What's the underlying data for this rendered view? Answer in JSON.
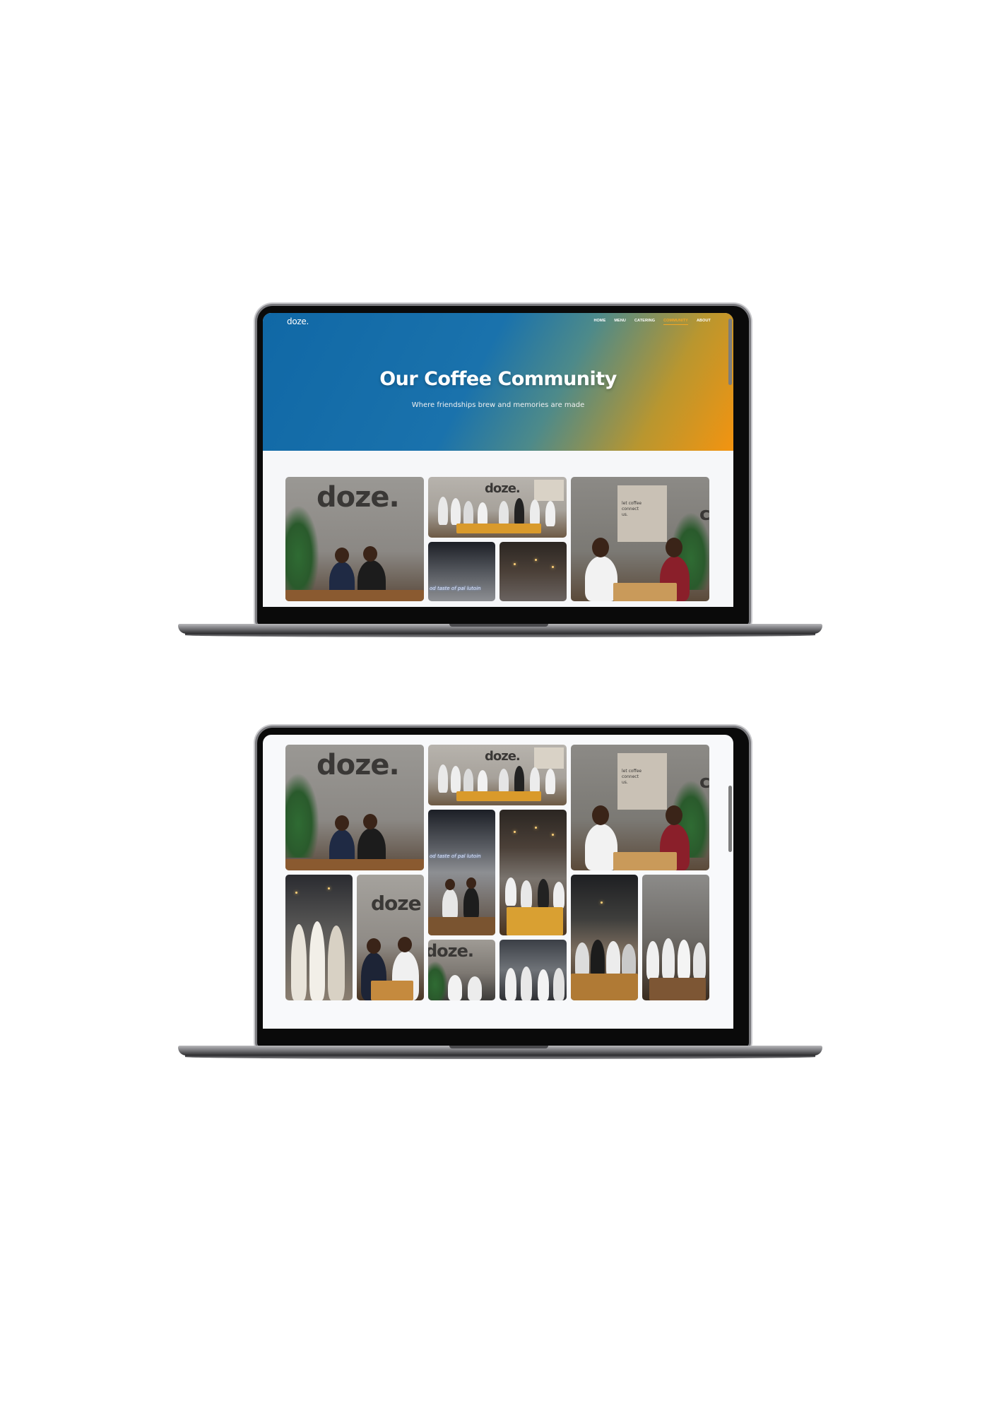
{
  "site": {
    "logo": "doze.",
    "nav": [
      "HOME",
      "MENU",
      "CATERING",
      "COMMUNITY",
      "ABOUT"
    ],
    "active_nav": "COMMUNITY"
  },
  "hero": {
    "title": "Our Coffee Community",
    "subtitle": "Where friendships brew and memories are made"
  },
  "photos": {
    "wall_logo": "doze.",
    "wall_logo_small": "doze.",
    "wall_logo_partial": "doze",
    "wall_logo_partial2": "doze.",
    "neon_sign": "od taste of pal lutoin",
    "neon_sign2": "od taste of pal lutoin",
    "board_text": "let coffee connect us.",
    "edge_letter": "c"
  },
  "colors": {
    "hero_start": "#1068a6",
    "hero_end": "#f39410",
    "active_nav": "#f5a623"
  }
}
